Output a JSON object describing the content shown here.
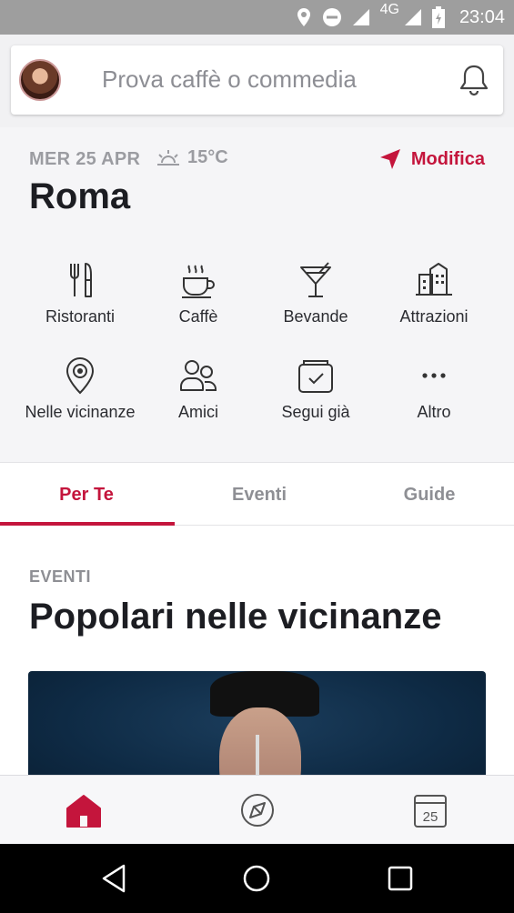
{
  "status_bar": {
    "time": "23:04",
    "network": "4G"
  },
  "search": {
    "placeholder": "Prova caffè o commedia"
  },
  "header": {
    "date": "MER 25 APR",
    "temperature": "15°C",
    "modify_label": "Modifica",
    "city": "Roma"
  },
  "categories": [
    {
      "label": "Ristoranti",
      "icon": "fork-knife-icon"
    },
    {
      "label": "Caffè",
      "icon": "coffee-cup-icon"
    },
    {
      "label": "Bevande",
      "icon": "cocktail-icon"
    },
    {
      "label": "Attrazioni",
      "icon": "buildings-icon"
    },
    {
      "label": "Nelle vicinanze",
      "icon": "location-pin-icon"
    },
    {
      "label": "Amici",
      "icon": "friends-icon"
    },
    {
      "label": "Segui già",
      "icon": "followed-box-icon"
    },
    {
      "label": "Altro",
      "icon": "more-dots-icon"
    }
  ],
  "tabs": [
    {
      "label": "Per Te",
      "active": true
    },
    {
      "label": "Eventi",
      "active": false
    },
    {
      "label": "Guide",
      "active": false
    }
  ],
  "section": {
    "kicker": "EVENTI",
    "title": "Popolari nelle vicinanze"
  },
  "bottom_nav": {
    "calendar_day": "25"
  },
  "colors": {
    "accent": "#c4153c",
    "text": "#1c1d22",
    "muted": "#8e8f94"
  }
}
